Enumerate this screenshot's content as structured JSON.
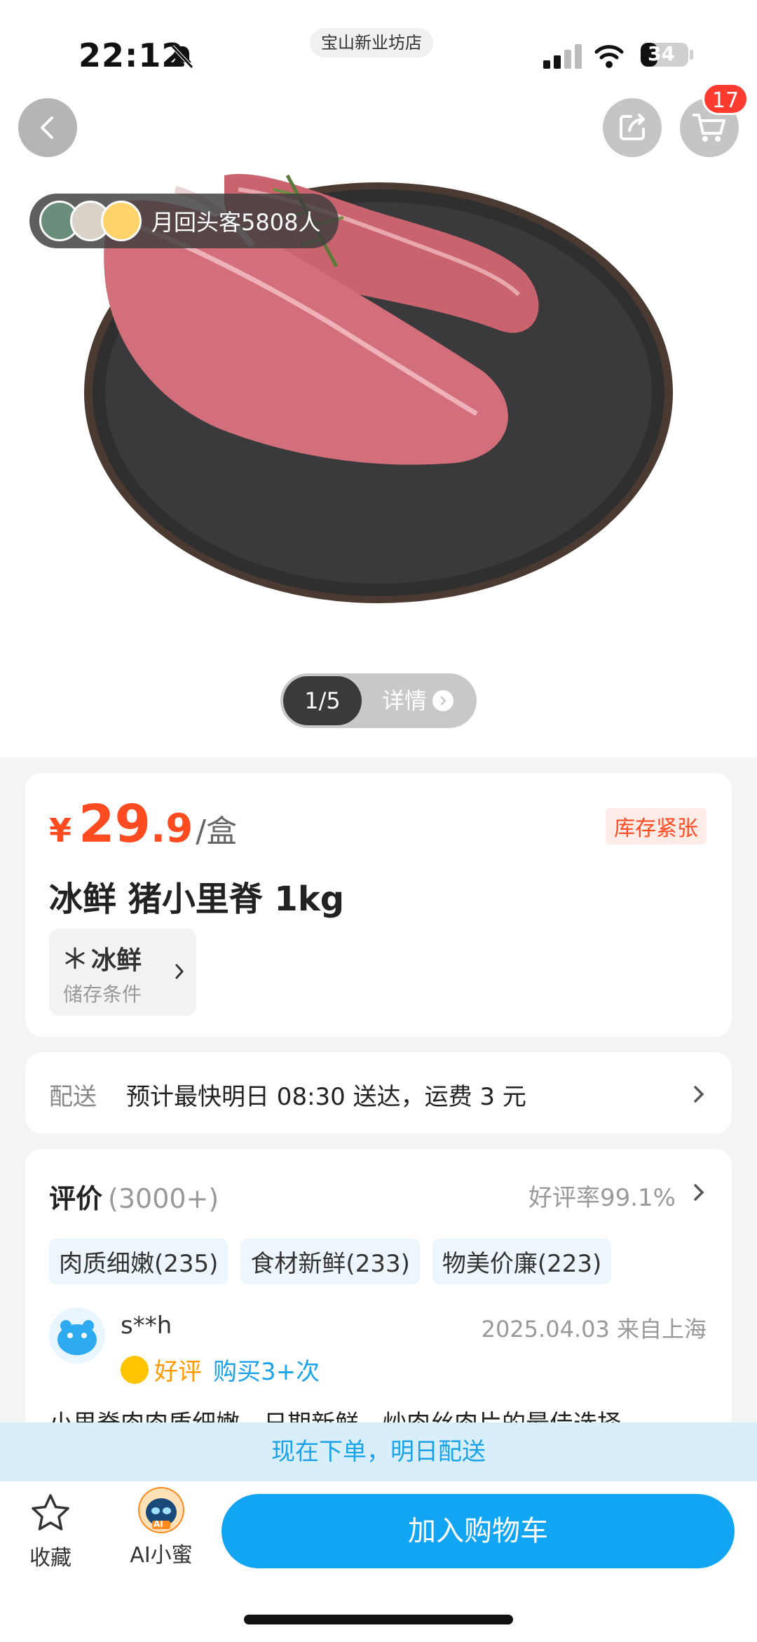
{
  "status_bar": {
    "time": "22:12",
    "store": "宝山新业坊店",
    "battery": "34"
  },
  "header": {
    "cart_count": "17"
  },
  "hero": {
    "returning_customers": "月回头客5808人",
    "pager_index": "1/5",
    "pager_detail": "详情"
  },
  "product": {
    "currency": "¥",
    "price_int": "29",
    "price_dec": ".9",
    "unit": "/盒",
    "stock_tag": "库存紧张",
    "title": "冰鲜 猪小里脊 1kg",
    "storage_value": "冰鲜",
    "storage_label": "储存条件"
  },
  "delivery": {
    "label": "配送",
    "text": "预计最快明日 08:30 送达，运费 3 元"
  },
  "reviews": {
    "heading": "评价",
    "count": "(3000+)",
    "rate": "好评率99.1%",
    "tags": [
      "肉质细嫩(235)",
      "食材新鲜(233)",
      "物美价廉(223)"
    ],
    "first": {
      "user": "s**h",
      "date": "2025.04.03 来自上海",
      "badge": "好评",
      "repeat": "购买3+次",
      "text": "小里脊肉肉质细嫩，日期新鲜，炒肉丝肉片的最佳选择"
    }
  },
  "promo": "现在下单，明日配送",
  "bottom": {
    "fav_label": "收藏",
    "ai_label": "AI小蜜",
    "ai_badge": "AI",
    "add_cart": "加入购物车"
  },
  "colors": {
    "price": "#ff4b1f",
    "accent_blue": "#12a5f4",
    "promo_bg": "#d8eefb"
  }
}
